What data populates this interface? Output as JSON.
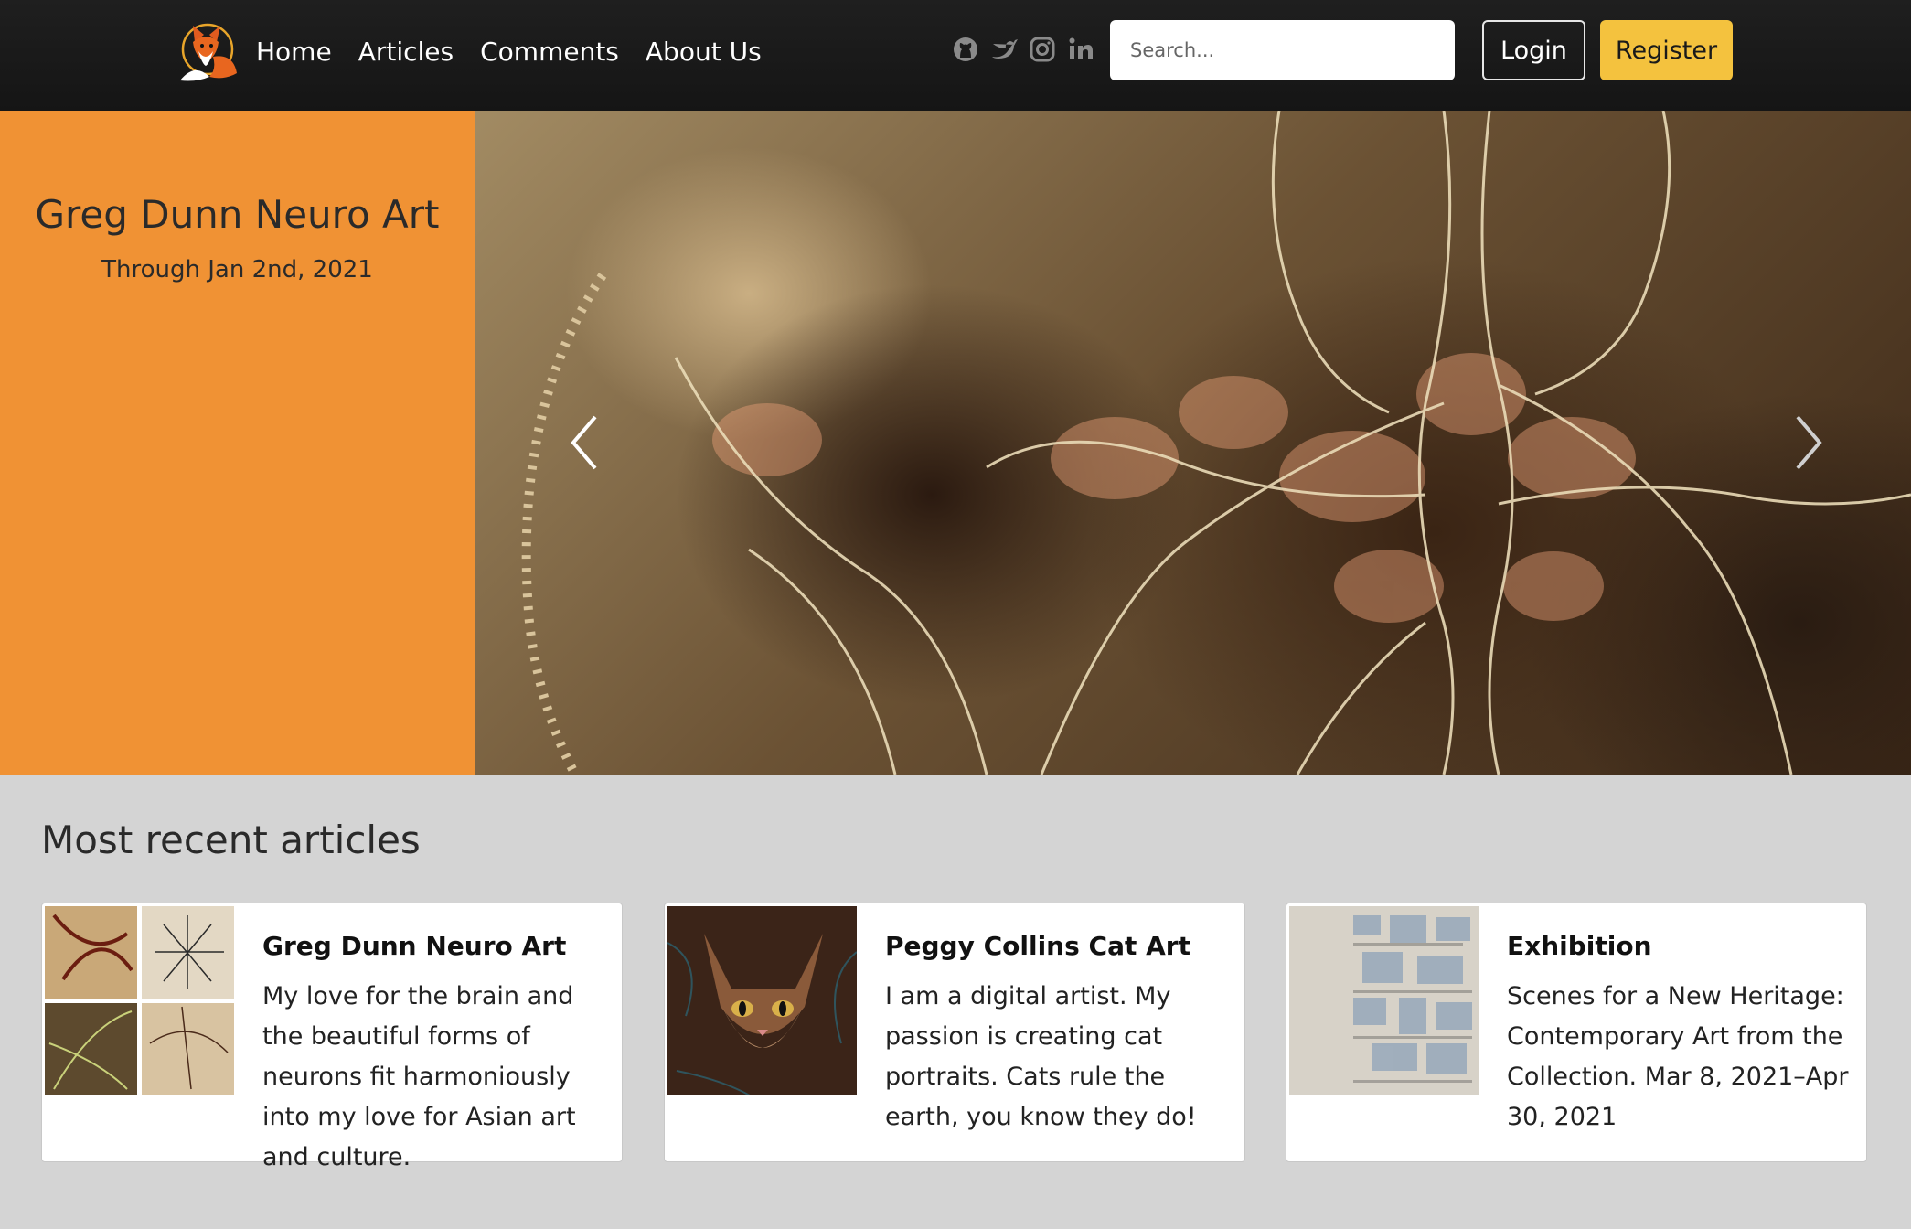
{
  "nav": {
    "links": [
      "Home",
      "Articles",
      "Comments",
      "About Us"
    ],
    "social_icons": [
      "github-icon",
      "twitter-icon",
      "instagram-icon",
      "linkedin-icon"
    ],
    "search_placeholder": "Search...",
    "login_label": "Login",
    "register_label": "Register"
  },
  "hero": {
    "title": "Greg Dunn Neuro Art",
    "subtitle": "Through Jan 2nd, 2021"
  },
  "articles": {
    "heading": "Most recent articles",
    "items": [
      {
        "title": "Greg Dunn Neuro Art",
        "text": "My love for the brain and the beautiful forms of neurons fit harmoniously into my love for Asian art and culture."
      },
      {
        "title": "Peggy Collins Cat Art",
        "text": "I am a digital artist. My passion is creating cat portraits. Cats rule the earth, you know they do!"
      },
      {
        "title": "Exhibition",
        "text": "Scenes for a New Heritage: Contemporary Art from the Collection. Mar 8, 2021–Apr 30, 2021"
      }
    ]
  },
  "colors": {
    "accent_orange": "#f09234",
    "register_yellow": "#f4c23e",
    "navbar": "#1a1a1a",
    "page_bg": "#d4d4d4"
  }
}
